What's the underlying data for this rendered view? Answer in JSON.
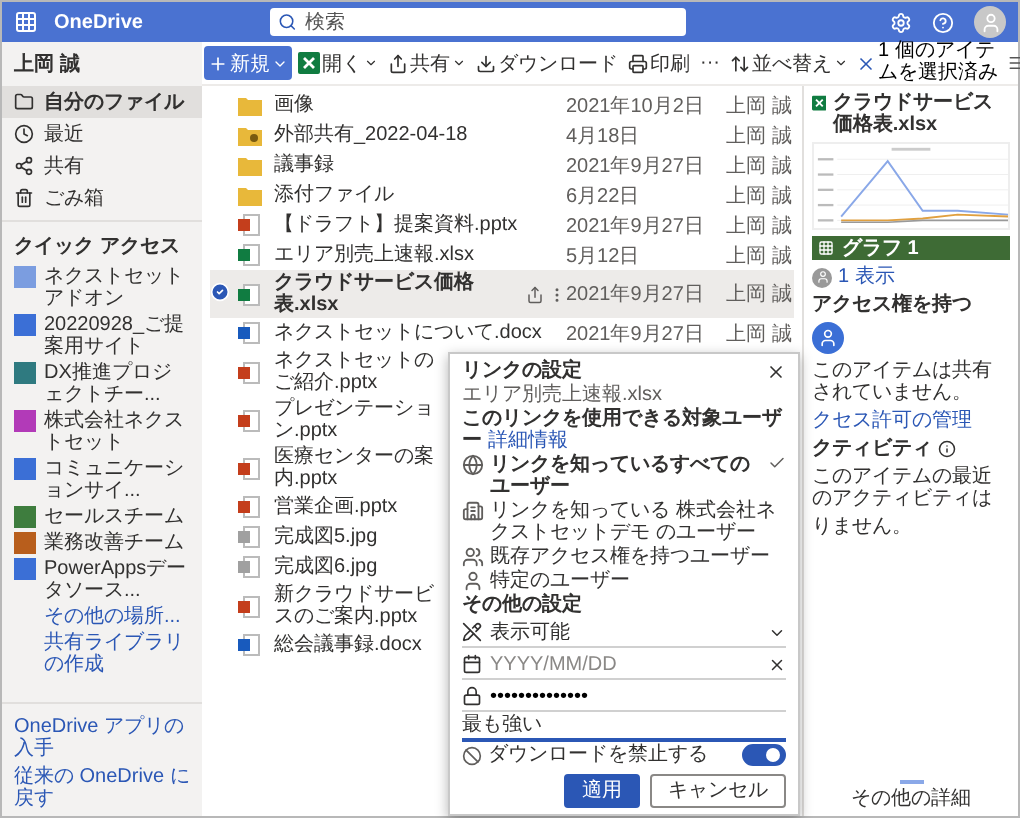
{
  "top_bar": {
    "app_name": "OneDrive",
    "search": {
      "placeholder": "検索"
    }
  },
  "user_name": "上岡 誠",
  "nav": [
    {
      "label": "自分のファイル",
      "selected": true
    },
    {
      "label": "最近",
      "selected": false
    },
    {
      "label": "共有",
      "selected": false
    },
    {
      "label": "ごみ箱",
      "selected": false
    }
  ],
  "quick_access": {
    "title": "クイック アクセス",
    "sites": [
      {
        "label": "ネクストセットアドオン",
        "color": "#7b9de0"
      },
      {
        "label": "20220928_ご提案用サイト",
        "color": "#3b6fd6"
      },
      {
        "label": "DX推進プロジェクトチー...",
        "color": "#2f7a80"
      },
      {
        "label": "株式会社ネクストセット",
        "color": "#b23ab8"
      },
      {
        "label": "コミュニケーションサイ...",
        "color": "#3b6fd6"
      },
      {
        "label": "セールスチーム",
        "color": "#3e7d3e"
      },
      {
        "label": "業務改善チーム",
        "color": "#b85e1c"
      },
      {
        "label": "PowerAppsデータソース...",
        "color": "#3b6fd6"
      }
    ],
    "links": [
      "その他の場所...",
      "共有ライブラリの作成"
    ]
  },
  "footer_links": [
    "OneDrive アプリの入手",
    "従来の OneDrive に戻す"
  ],
  "commands": [
    {
      "kind": "primary",
      "label": "新規"
    },
    {
      "kind": "menu",
      "label": "開く"
    },
    {
      "kind": "menu",
      "label": "共有"
    },
    {
      "kind": "plain",
      "label": "ダウンロード"
    },
    {
      "kind": "plain",
      "label": "印刷"
    },
    {
      "kind": "more",
      "label": "···"
    },
    {
      "kind": "menu",
      "label": "並べ替え"
    }
  ],
  "selection": {
    "label": "1 個のアイテムを選択済み"
  },
  "files": [
    {
      "kind": "folder",
      "name": "画像",
      "date": "2021年10月2日",
      "owner": "上岡 誠",
      "selected": false
    },
    {
      "kind": "shared-folder",
      "name": "外部共有_2022-04-18",
      "date": "4月18日",
      "owner": "上岡 誠",
      "selected": false
    },
    {
      "kind": "folder",
      "name": "議事録",
      "date": "2021年9月27日",
      "owner": "上岡 誠",
      "selected": false
    },
    {
      "kind": "folder",
      "name": "添付ファイル",
      "date": "6月22日",
      "owner": "上岡 誠",
      "selected": false
    },
    {
      "kind": "pptx",
      "name": "【ドラフト】提案資料.pptx",
      "date": "2021年9月27日",
      "owner": "上岡 誠",
      "selected": false
    },
    {
      "kind": "xlsx",
      "name": "エリア別売上速報.xlsx",
      "date": "5月12日",
      "owner": "上岡 誠",
      "selected": false
    },
    {
      "kind": "xlsx",
      "name": "クラウドサービス価格表.xlsx",
      "date": "2021年9月27日",
      "owner": "上岡 誠",
      "selected": true
    },
    {
      "kind": "docx",
      "name": "ネクストセットについて.docx",
      "date": "2021年9月27日",
      "owner": "上岡 誠",
      "selected": false
    },
    {
      "kind": "pptx",
      "name": "ネクストセットのご紹介.pptx",
      "selected": false
    },
    {
      "kind": "pptx",
      "name": "プレゼンテーション.pptx",
      "selected": false
    },
    {
      "kind": "pptx",
      "name": "医療センターの案内.pptx",
      "selected": false
    },
    {
      "kind": "pptx",
      "name": "営業企画.pptx",
      "selected": false
    },
    {
      "kind": "image",
      "name": "完成図5.jpg",
      "selected": false
    },
    {
      "kind": "image",
      "name": "完成図6.jpg",
      "selected": false
    },
    {
      "kind": "pptx",
      "name": "新クラウドサービスのご案内.pptx",
      "selected": false
    },
    {
      "kind": "docx",
      "name": "総会議事録.docx",
      "selected": false
    }
  ],
  "details": {
    "title": "クラウドサービス価格表.xlsx",
    "chart_tab": "グラフ 1",
    "views": "1 表示",
    "access": {
      "heading": "アクセス権を持つ",
      "text": "このアイテムは共有されていません。",
      "link": "クセス許可の管理"
    },
    "activity": {
      "heading": "クティビティ",
      "lines": [
        "このアイテムの最近のアクティビティは",
        "りません。"
      ]
    },
    "more": "その他の詳細"
  },
  "dialog": {
    "title": "リンクの設定",
    "file": "エリア別売上速報.xlsx",
    "audience_heading": "このリンクを使用できる対象ユーザー",
    "details_link": "詳細情報",
    "options": [
      {
        "label": "リンクを知っているすべてのユーザー",
        "selected": true
      },
      {
        "label": "リンクを知っている 株式会社ネクストセットデモ のユーザー",
        "selected": false
      },
      {
        "label": "既存アクセス権を持つユーザー",
        "selected": false
      },
      {
        "label": "特定のユーザー",
        "selected": false
      }
    ],
    "settings_heading": "その他の設定",
    "permission": "表示可能",
    "expiry": {
      "placeholder": "YYYY/MM/DD"
    },
    "password": {
      "value": "••••••••••••••",
      "strength": "最も強い",
      "level": 1
    },
    "block_download": {
      "label": "ダウンロードを禁止する",
      "on": true
    },
    "buttons": [
      {
        "kind": "primary",
        "label": "適用"
      },
      {
        "kind": "secondary",
        "label": "キャンセル"
      }
    ]
  }
}
